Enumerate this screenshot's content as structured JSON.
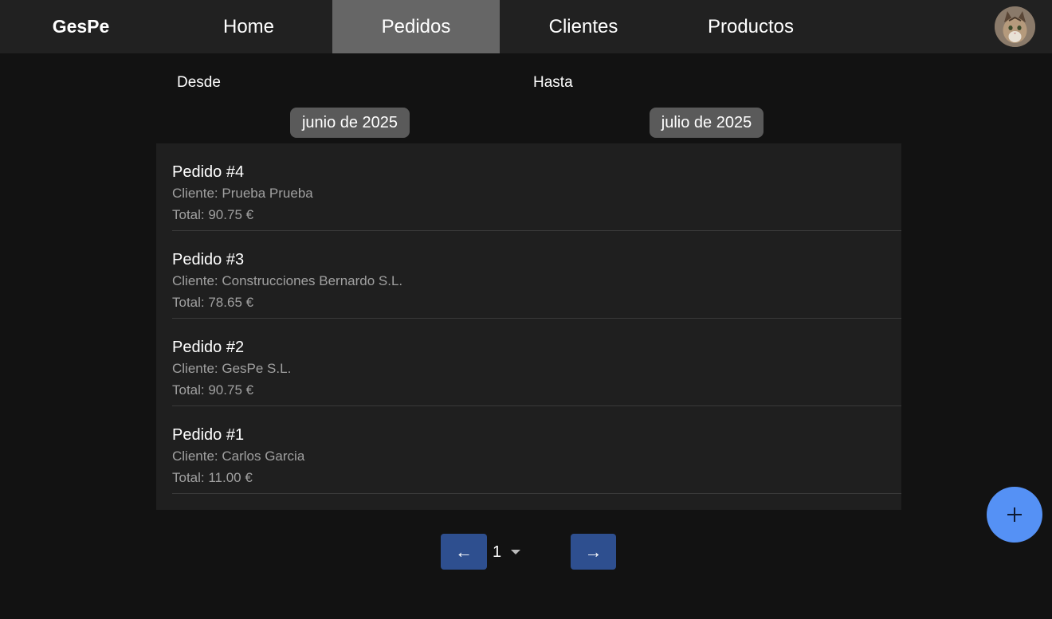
{
  "brand": "GesPe",
  "nav": {
    "home": "Home",
    "pedidos": "Pedidos",
    "clientes": "Clientes",
    "productos": "Productos"
  },
  "filters": {
    "desde_label": "Desde",
    "desde_value": "junio de 2025",
    "hasta_label": "Hasta",
    "hasta_value": "julio de 2025"
  },
  "orders": [
    {
      "title": "Pedido #4",
      "client": "Cliente: Prueba Prueba",
      "total": "Total: 90.75 €"
    },
    {
      "title": "Pedido #3",
      "client": "Cliente: Construcciones Bernardo S.L.",
      "total": "Total: 78.65 €"
    },
    {
      "title": "Pedido #2",
      "client": "Cliente: GesPe S.L.",
      "total": "Total: 90.75 €"
    },
    {
      "title": "Pedido #1",
      "client": "Cliente: Carlos Garcia",
      "total": "Total: 11.00 €"
    }
  ],
  "pagination": {
    "prev_label": "←",
    "current_page": "1",
    "next_label": "→"
  },
  "colors": {
    "background": "#121212",
    "navbar": "#212121",
    "active_tab": "#666666",
    "accent_fab": "#5591f5",
    "pagination_button": "#2e4f8f"
  },
  "icons": {
    "avatar": "cat-avatar",
    "fab": "plus-icon",
    "page_select": "caret-down-icon"
  }
}
